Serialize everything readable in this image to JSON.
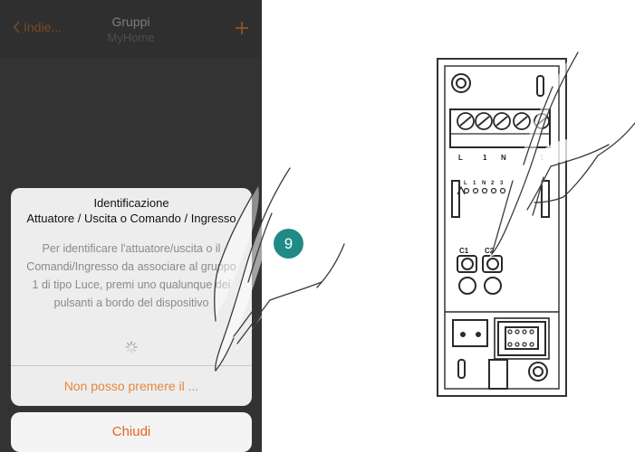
{
  "navbar": {
    "back_label": "Indie...",
    "title": "Gruppi",
    "subtitle": "MyHome",
    "add_icon": "plus-icon"
  },
  "alert": {
    "title_line1": "Identificazione",
    "title_line2": "Attuatore / Uscita o Comando / Ingresso",
    "message": "Per identificare l'attuatore/uscita o il Comandi/Ingresso da associare al gruppo 1 di tipo Luce, premi uno qualunque dei pulsanti a bordo del dispositivo",
    "action_label": "Non posso premere il ...",
    "cancel_label": "Chiudi"
  },
  "step": {
    "number": "9"
  },
  "device": {
    "terminal_labels": [
      "L",
      "1",
      "N",
      "1"
    ],
    "pin_labels": [
      "L",
      "1",
      "N",
      "2",
      "3"
    ],
    "button_labels": [
      "C1",
      "C2"
    ]
  },
  "colors": {
    "accent_orange": "#e8863a",
    "badge_teal": "#1f8a86",
    "nav_background": "#2f2f2f"
  }
}
